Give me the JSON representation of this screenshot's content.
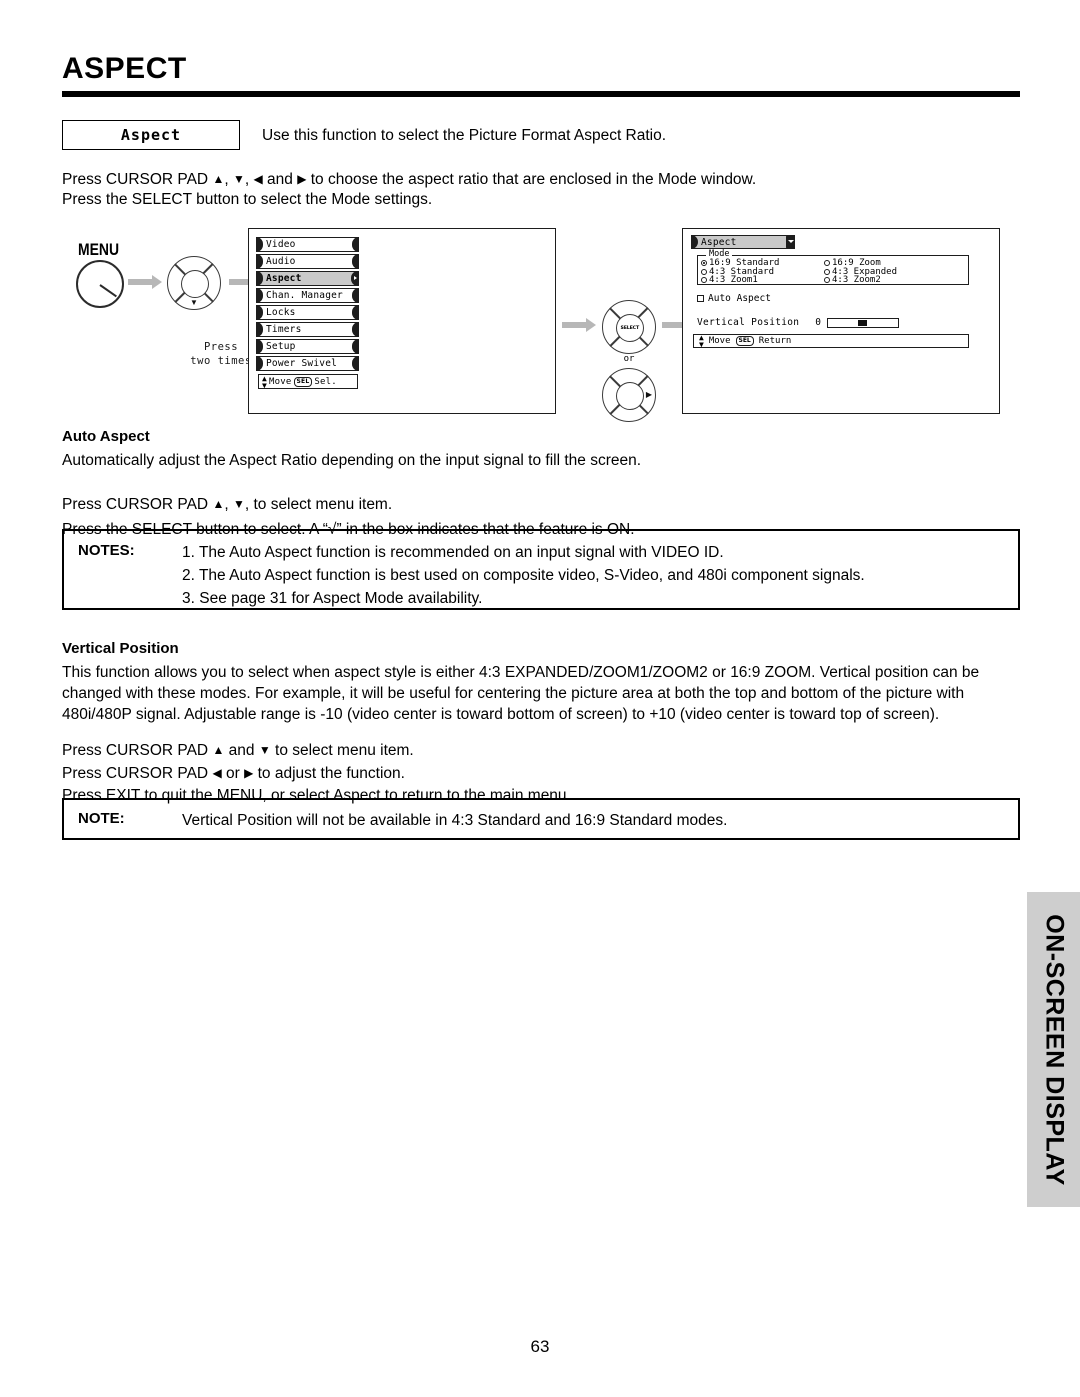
{
  "page": {
    "title": "ASPECT",
    "number": "63",
    "side_tab": "ON-SCREEN DISPLAY"
  },
  "intro": {
    "chip_label": "Aspect",
    "chip_description": "Use this function to select the Picture Format Aspect Ratio.",
    "line1_a": "Press CURSOR PAD  ",
    "line1_tri_up": "▲",
    "line1_b": ", ",
    "line1_tri_down": "▼",
    "line1_c": ", ",
    "line1_tri_left": "◀",
    "line1_d": " and ",
    "line1_tri_right": "▶",
    "line1_e": " to choose the aspect ratio that are enclosed in the Mode window.",
    "line2": "Press the SELECT button  to select the Mode settings."
  },
  "diagram": {
    "menu_button_label": "MENU",
    "press_twice_line1": "Press",
    "press_twice_line2": "two times",
    "select_pad_label": "SELECT",
    "or_label": "or",
    "menu_items": [
      "Video",
      "Audio",
      "Aspect",
      "Chan. Manager",
      "Locks",
      "Timers",
      "Setup",
      "Power Swivel"
    ],
    "menu_selected": "Aspect",
    "menu_footer_move": "Move",
    "menu_footer_key": "SEL",
    "menu_footer_sel": "Sel.",
    "osd": {
      "header": "Aspect",
      "mode_legend": "Mode",
      "modes": [
        {
          "label": "16:9 Standard",
          "selected": true
        },
        {
          "label": "16:9 Zoom",
          "selected": false
        },
        {
          "label": "4:3 Standard",
          "selected": false
        },
        {
          "label": "4:3 Expanded",
          "selected": false
        },
        {
          "label": "4:3 Zoom1",
          "selected": false
        },
        {
          "label": "4:3 Zoom2",
          "selected": false
        }
      ],
      "auto_aspect_label": "Auto Aspect",
      "auto_aspect_checked": false,
      "vertical_position_label": "Vertical Position",
      "vertical_position_value": "0",
      "footer_move": "Move",
      "footer_key": "SEL",
      "footer_return": "Return"
    }
  },
  "auto_aspect": {
    "heading": "Auto Aspect",
    "description": "Automatically adjust the Aspect Ratio depending on the input signal to fill the screen.",
    "instr1_a": "Press CURSOR PAD  ",
    "instr1_tri_up": "▲",
    "instr1_b": ", ",
    "instr1_tri_down": "▼",
    "instr1_c": ", to select menu item.",
    "instr2": "Press the SELECT button  to select.  A “√” in the box indicates that the feature is ON.",
    "notes_label": "NOTES:",
    "notes": [
      "1. The Auto Aspect function is recommended on an input signal with VIDEO ID.",
      "2. The Auto Aspect function is best used on composite video, S-Video, and 480i component signals.",
      "3. See page 31 for Aspect Mode availability."
    ]
  },
  "vertical_position": {
    "heading": "Vertical Position",
    "para_line1": "This function allows you to select when aspect style is either 4:3 EXPANDED/ZOOM1/ZOOM2 or 16:9 ZOOM.  Vertical position can be",
    "para_line2": "changed with these modes.  For example, it will be useful for centering the picture area at both the top and bottom of the picture with",
    "para_line3": "480i/480P signal.  Adjustable range is -10 (video center is toward bottom of screen) to +10 (video center is toward top of screen).",
    "instr1_a": "Press CURSOR PAD  ",
    "instr1_tri_up": "▲",
    "instr1_b": " and ",
    "instr1_tri_down": "▼",
    "instr1_c": " to select menu item.",
    "instr2_a": "Press CURSOR PAD   ",
    "instr2_tri_left": "◀",
    "instr2_b": " or ",
    "instr2_tri_right": "▶",
    "instr2_c": " to adjust the function.",
    "instr3": "Press EXIT to quit the MENU, or select Aspect to return to the main menu.",
    "note_label": "NOTE:",
    "note_text": "Vertical Position will not be available in 4:3 Standard and 16:9 Standard modes."
  }
}
